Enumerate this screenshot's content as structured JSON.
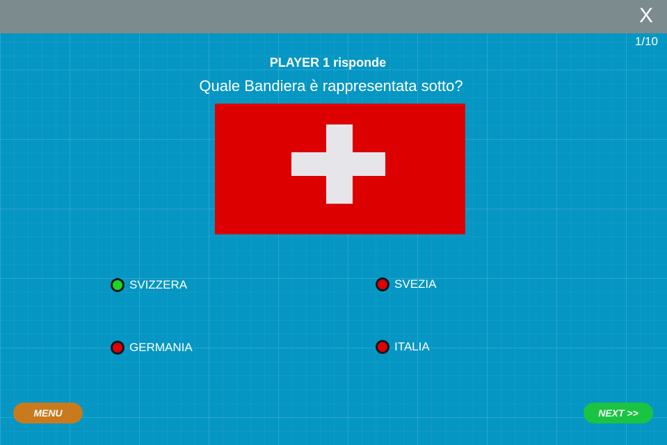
{
  "header": {
    "close_label": "X"
  },
  "progress": "1/10",
  "player_label": "PLAYER 1 risponde",
  "question": "Quale Bandiera è rappresentata sotto?",
  "flag": {
    "icon": "swiss-flag",
    "background_color": "#dc0000",
    "cross_color": "#e6e6ea"
  },
  "options": [
    {
      "label": "SVIZZERA",
      "state": "correct",
      "color": "#1fd61f"
    },
    {
      "label": "SVEZIA",
      "state": "wrong",
      "color": "#e00000"
    },
    {
      "label": "GERMANIA",
      "state": "wrong",
      "color": "#e00000"
    },
    {
      "label": "ITALIA",
      "state": "wrong",
      "color": "#e00000"
    }
  ],
  "buttons": {
    "menu_label": "MENU",
    "menu_color": "#c87a1c",
    "next_label": "NEXT >>",
    "next_color": "#1ac442"
  }
}
